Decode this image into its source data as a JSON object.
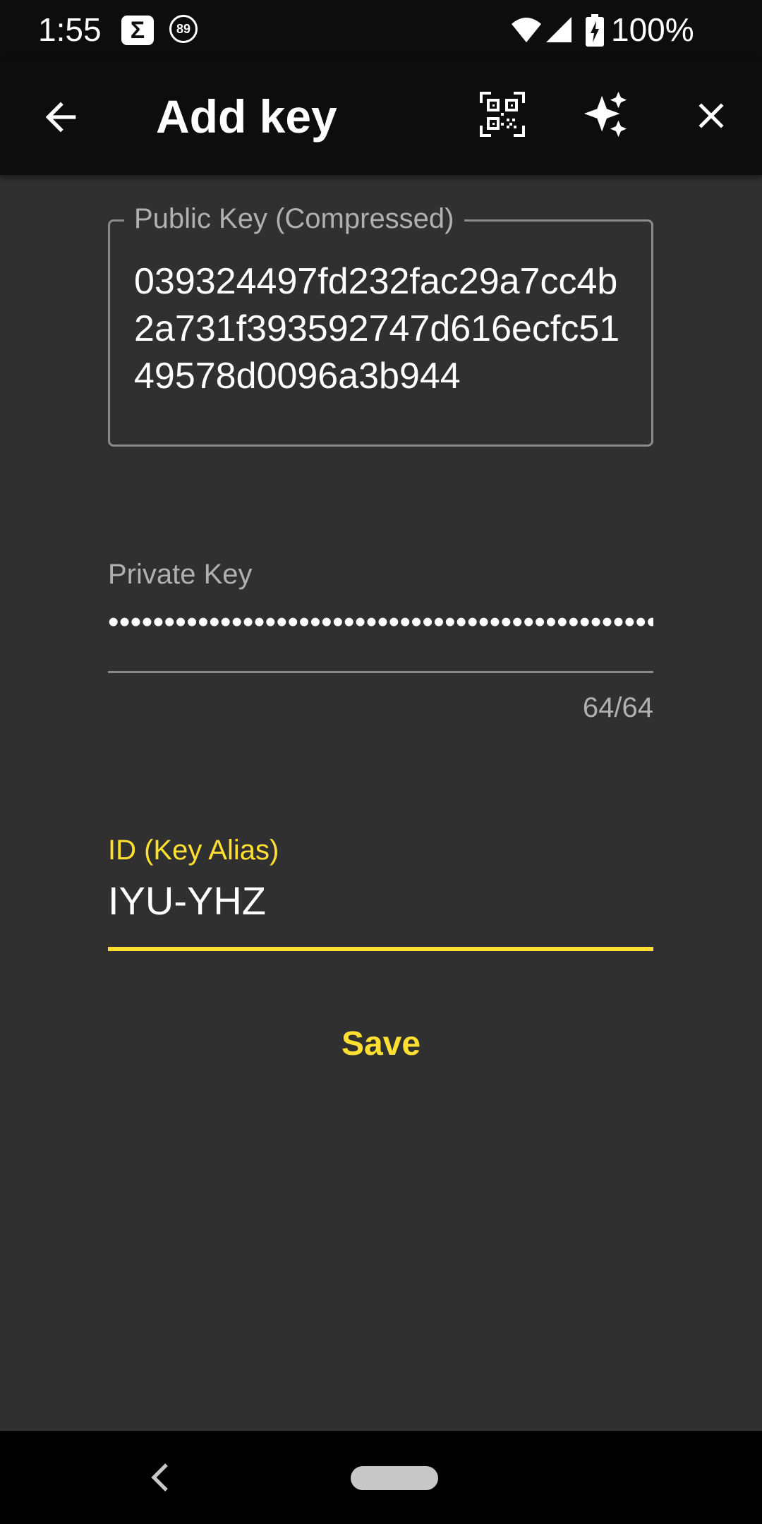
{
  "status_bar": {
    "time": "1:55",
    "notification_badge": "89",
    "battery": "100%"
  },
  "app_bar": {
    "title": "Add key",
    "icons": [
      "arrow-back-icon",
      "qr-code-icon",
      "auto-awesome-icon",
      "close-icon"
    ]
  },
  "form": {
    "public_key": {
      "label": "Public Key (Compressed)",
      "value": "039324497fd232fac29a7cc4b2a731f393592747d616ecfc5149578d0096a3b944"
    },
    "private_key": {
      "label": "Private Key",
      "masked_value": "••••••••••••••••••••••••••••••••••••••••••••••••••••••••••••••••",
      "counter": "64/64"
    },
    "alias": {
      "label": "ID (Key Alias)",
      "value": "IYU-YHZ"
    },
    "save_label": "Save"
  },
  "colors": {
    "accent": "#ffe032",
    "background": "#303030",
    "app_bar": "#0d0d0d"
  }
}
